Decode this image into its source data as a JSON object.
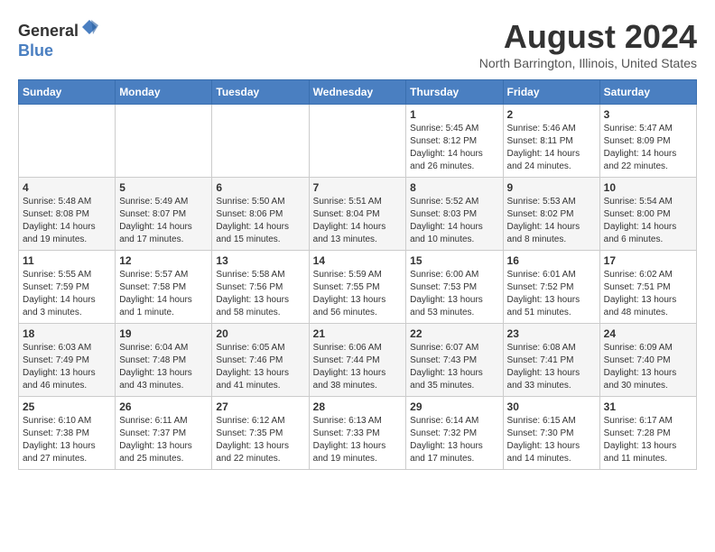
{
  "header": {
    "logo_line1": "General",
    "logo_line2": "Blue",
    "month": "August 2024",
    "location": "North Barrington, Illinois, United States"
  },
  "weekdays": [
    "Sunday",
    "Monday",
    "Tuesday",
    "Wednesday",
    "Thursday",
    "Friday",
    "Saturday"
  ],
  "weeks": [
    [
      {
        "day": "",
        "info": ""
      },
      {
        "day": "",
        "info": ""
      },
      {
        "day": "",
        "info": ""
      },
      {
        "day": "",
        "info": ""
      },
      {
        "day": "1",
        "info": "Sunrise: 5:45 AM\nSunset: 8:12 PM\nDaylight: 14 hours and 26 minutes."
      },
      {
        "day": "2",
        "info": "Sunrise: 5:46 AM\nSunset: 8:11 PM\nDaylight: 14 hours and 24 minutes."
      },
      {
        "day": "3",
        "info": "Sunrise: 5:47 AM\nSunset: 8:09 PM\nDaylight: 14 hours and 22 minutes."
      }
    ],
    [
      {
        "day": "4",
        "info": "Sunrise: 5:48 AM\nSunset: 8:08 PM\nDaylight: 14 hours and 19 minutes."
      },
      {
        "day": "5",
        "info": "Sunrise: 5:49 AM\nSunset: 8:07 PM\nDaylight: 14 hours and 17 minutes."
      },
      {
        "day": "6",
        "info": "Sunrise: 5:50 AM\nSunset: 8:06 PM\nDaylight: 14 hours and 15 minutes."
      },
      {
        "day": "7",
        "info": "Sunrise: 5:51 AM\nSunset: 8:04 PM\nDaylight: 14 hours and 13 minutes."
      },
      {
        "day": "8",
        "info": "Sunrise: 5:52 AM\nSunset: 8:03 PM\nDaylight: 14 hours and 10 minutes."
      },
      {
        "day": "9",
        "info": "Sunrise: 5:53 AM\nSunset: 8:02 PM\nDaylight: 14 hours and 8 minutes."
      },
      {
        "day": "10",
        "info": "Sunrise: 5:54 AM\nSunset: 8:00 PM\nDaylight: 14 hours and 6 minutes."
      }
    ],
    [
      {
        "day": "11",
        "info": "Sunrise: 5:55 AM\nSunset: 7:59 PM\nDaylight: 14 hours and 3 minutes."
      },
      {
        "day": "12",
        "info": "Sunrise: 5:57 AM\nSunset: 7:58 PM\nDaylight: 14 hours and 1 minute."
      },
      {
        "day": "13",
        "info": "Sunrise: 5:58 AM\nSunset: 7:56 PM\nDaylight: 13 hours and 58 minutes."
      },
      {
        "day": "14",
        "info": "Sunrise: 5:59 AM\nSunset: 7:55 PM\nDaylight: 13 hours and 56 minutes."
      },
      {
        "day": "15",
        "info": "Sunrise: 6:00 AM\nSunset: 7:53 PM\nDaylight: 13 hours and 53 minutes."
      },
      {
        "day": "16",
        "info": "Sunrise: 6:01 AM\nSunset: 7:52 PM\nDaylight: 13 hours and 51 minutes."
      },
      {
        "day": "17",
        "info": "Sunrise: 6:02 AM\nSunset: 7:51 PM\nDaylight: 13 hours and 48 minutes."
      }
    ],
    [
      {
        "day": "18",
        "info": "Sunrise: 6:03 AM\nSunset: 7:49 PM\nDaylight: 13 hours and 46 minutes."
      },
      {
        "day": "19",
        "info": "Sunrise: 6:04 AM\nSunset: 7:48 PM\nDaylight: 13 hours and 43 minutes."
      },
      {
        "day": "20",
        "info": "Sunrise: 6:05 AM\nSunset: 7:46 PM\nDaylight: 13 hours and 41 minutes."
      },
      {
        "day": "21",
        "info": "Sunrise: 6:06 AM\nSunset: 7:44 PM\nDaylight: 13 hours and 38 minutes."
      },
      {
        "day": "22",
        "info": "Sunrise: 6:07 AM\nSunset: 7:43 PM\nDaylight: 13 hours and 35 minutes."
      },
      {
        "day": "23",
        "info": "Sunrise: 6:08 AM\nSunset: 7:41 PM\nDaylight: 13 hours and 33 minutes."
      },
      {
        "day": "24",
        "info": "Sunrise: 6:09 AM\nSunset: 7:40 PM\nDaylight: 13 hours and 30 minutes."
      }
    ],
    [
      {
        "day": "25",
        "info": "Sunrise: 6:10 AM\nSunset: 7:38 PM\nDaylight: 13 hours and 27 minutes."
      },
      {
        "day": "26",
        "info": "Sunrise: 6:11 AM\nSunset: 7:37 PM\nDaylight: 13 hours and 25 minutes."
      },
      {
        "day": "27",
        "info": "Sunrise: 6:12 AM\nSunset: 7:35 PM\nDaylight: 13 hours and 22 minutes."
      },
      {
        "day": "28",
        "info": "Sunrise: 6:13 AM\nSunset: 7:33 PM\nDaylight: 13 hours and 19 minutes."
      },
      {
        "day": "29",
        "info": "Sunrise: 6:14 AM\nSunset: 7:32 PM\nDaylight: 13 hours and 17 minutes."
      },
      {
        "day": "30",
        "info": "Sunrise: 6:15 AM\nSunset: 7:30 PM\nDaylight: 13 hours and 14 minutes."
      },
      {
        "day": "31",
        "info": "Sunrise: 6:17 AM\nSunset: 7:28 PM\nDaylight: 13 hours and 11 minutes."
      }
    ]
  ]
}
